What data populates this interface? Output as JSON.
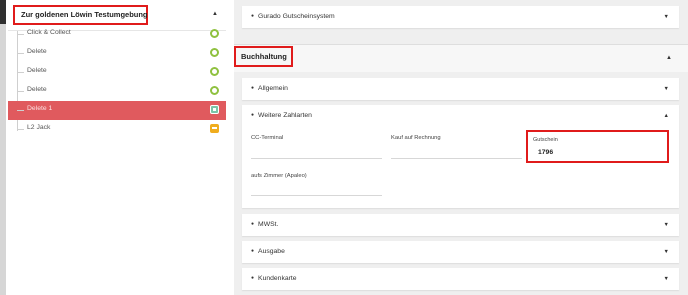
{
  "tree": {
    "title": "Zur goldenen Löwin Testumgebung",
    "items": [
      {
        "label": "Click & Collect",
        "status": "circle"
      },
      {
        "label": "Delete",
        "status": "circle"
      },
      {
        "label": "Delete",
        "status": "circle"
      },
      {
        "label": "Delete",
        "status": "circle"
      },
      {
        "label": "Delete 1",
        "status": "selected"
      },
      {
        "label": "L2 Jack",
        "status": "warning"
      }
    ]
  },
  "right": {
    "top_card": "Gurado Gutscheinsystem",
    "section_title": "Buchhaltung",
    "cards": {
      "allgemein": "Allgemein",
      "weitere": "Weitere Zahlarten",
      "mwst": "MWSt.",
      "ausgabe": "Ausgabe",
      "kundenkarte": "Kundenkarte"
    },
    "fields": {
      "cc_terminal": "CC-Terminal",
      "kauf_auf_rechnung": "Kauf auf Rechnung",
      "gutschein_label": "Gutschein",
      "gutschein_value": "1796",
      "aufs_zimmer": "aufs Zimmer (Apaleo)"
    }
  },
  "colors": {
    "highlight_box": "#e01b1b",
    "selected_row": "#e05a5e",
    "status_ok": "#8fc13f",
    "status_warning": "#f0ad1e"
  },
  "icons": {
    "collapse": "chevron-up-icon",
    "expand": "chevron-down-icon",
    "ok": "circle-icon",
    "selected": "square-icon",
    "warning": "minus-square-icon"
  }
}
